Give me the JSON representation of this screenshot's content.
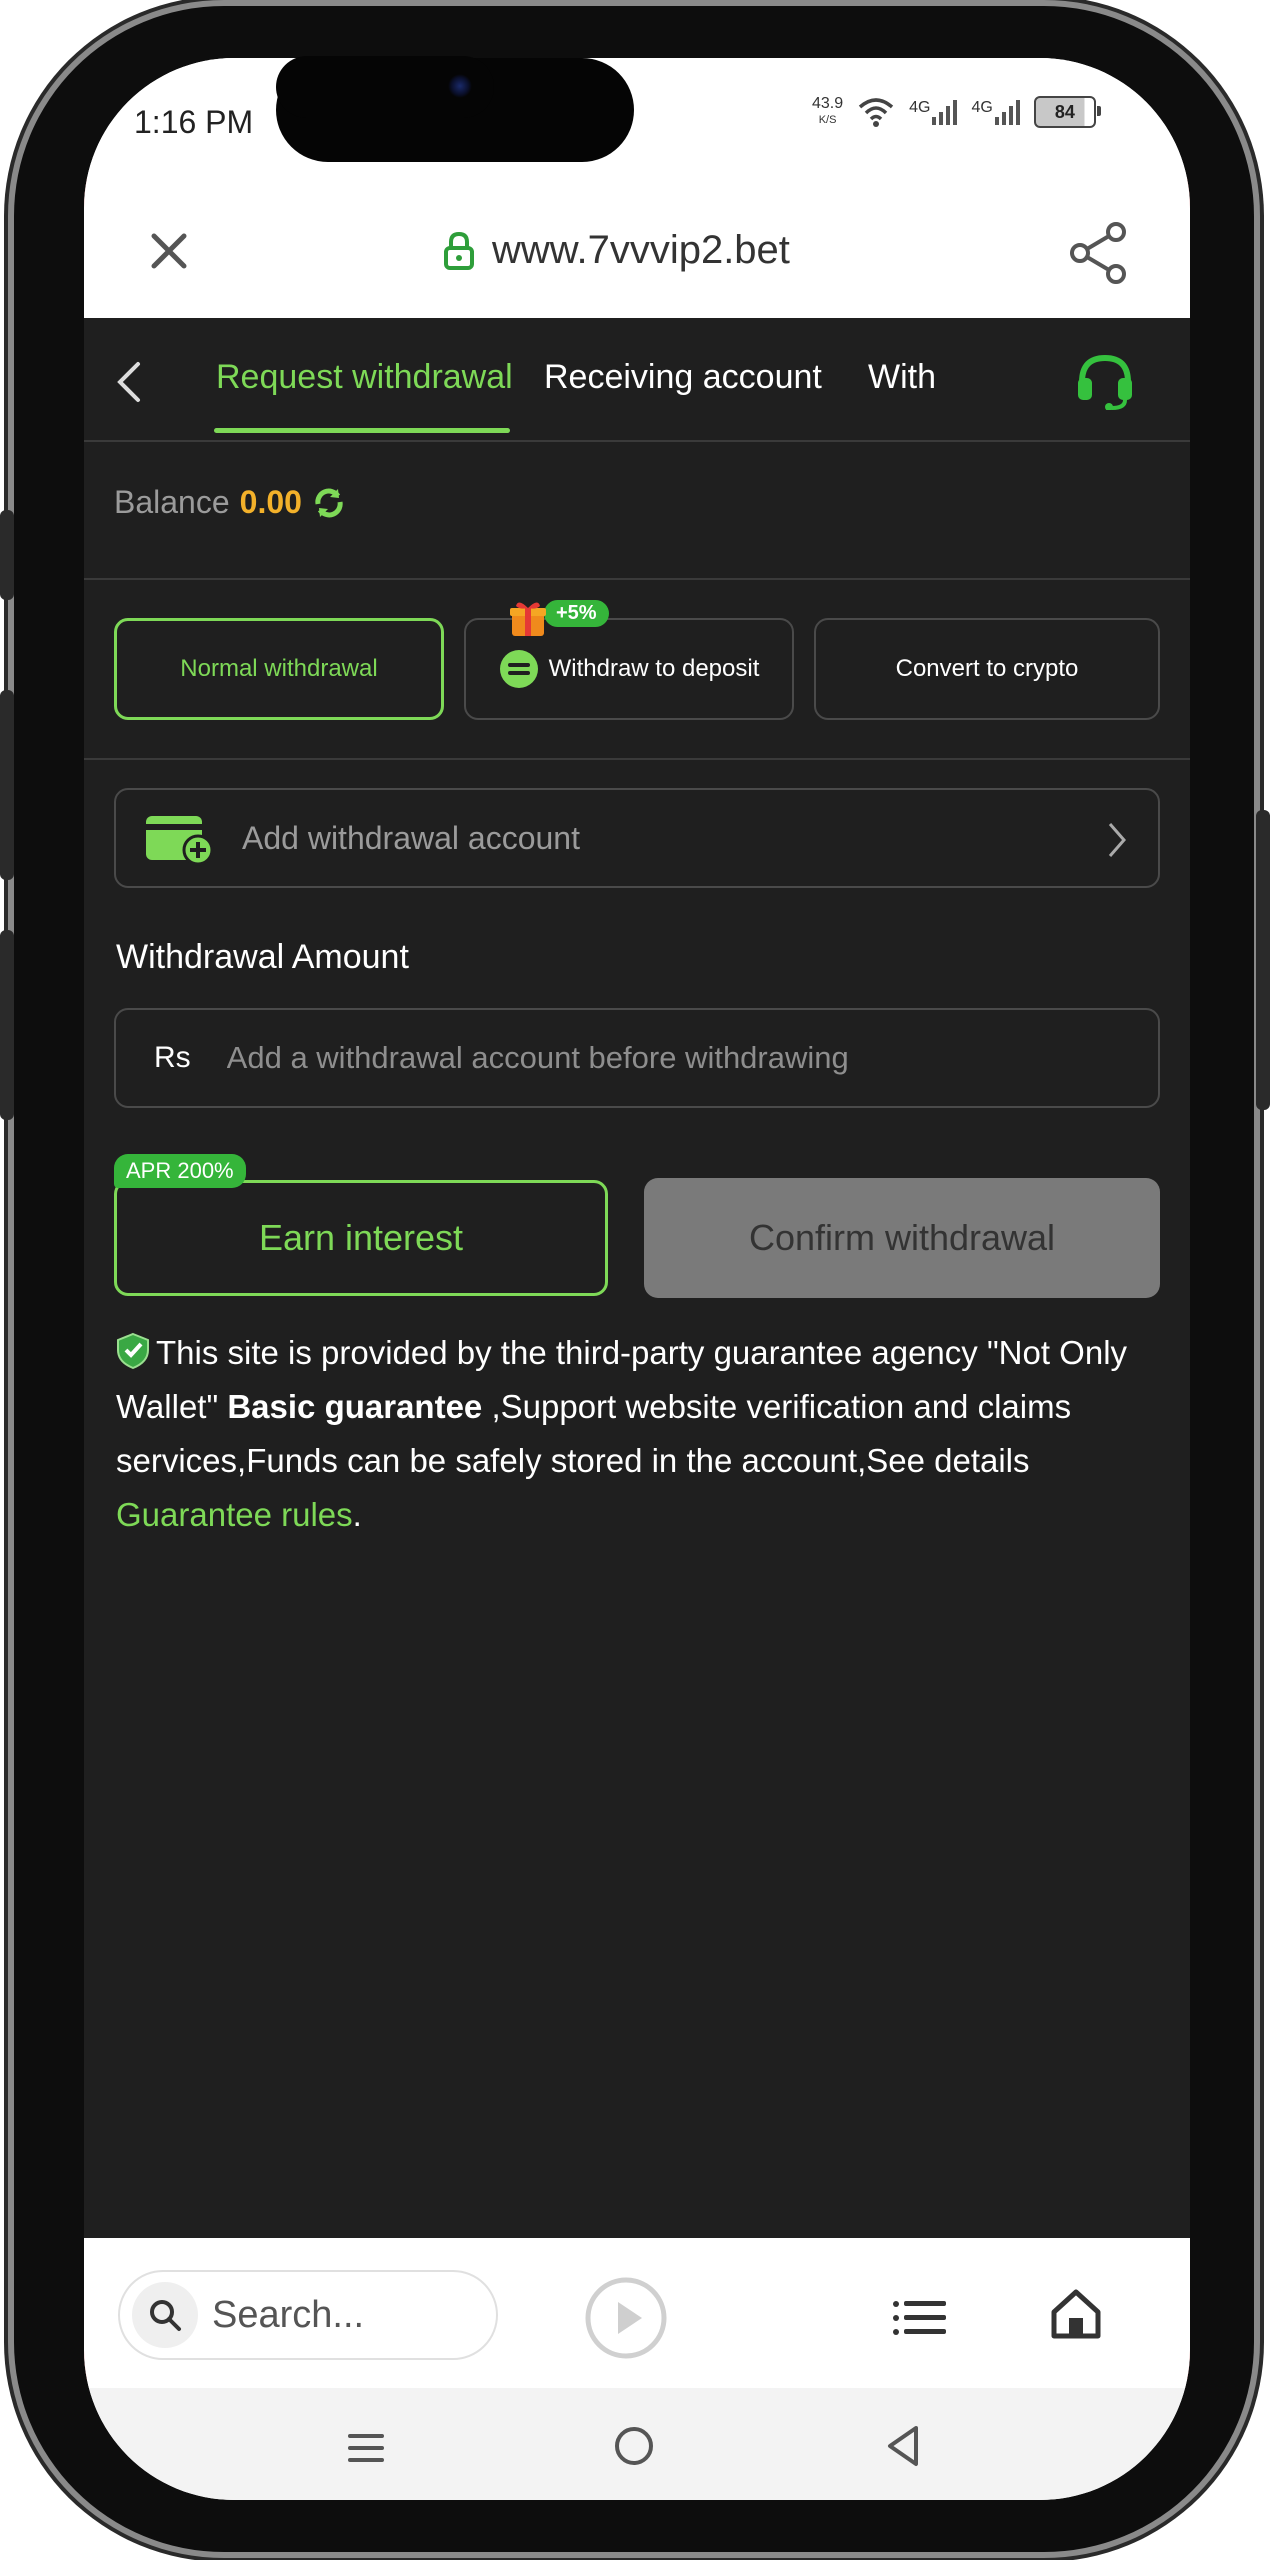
{
  "status_bar": {
    "time": "1:16 PM",
    "net_speed_value": "43.9",
    "net_speed_unit": "K/S",
    "signal_1": "4G",
    "signal_2": "4G",
    "battery": "84"
  },
  "url_bar": {
    "url": "www.7vvvip2.bet",
    "icons": [
      "close-icon",
      "lock-icon",
      "share-icon"
    ]
  },
  "tabs": [
    {
      "label": "Request withdrawal",
      "active": true
    },
    {
      "label": "Receiving account",
      "active": false
    },
    {
      "label": "With",
      "active": false
    }
  ],
  "balance": {
    "label": "Balance",
    "amount": "0.00"
  },
  "withdraw_types": [
    {
      "label": "Normal withdrawal",
      "active": true
    },
    {
      "label": "Withdraw to deposit",
      "badge": "+5%",
      "active": false
    },
    {
      "label": "Convert to crypto",
      "active": false
    }
  ],
  "add_account": {
    "label": "Add withdrawal account"
  },
  "amount": {
    "label": "Withdrawal Amount",
    "currency": "Rs",
    "placeholder": "Add a withdrawal account before withdrawing"
  },
  "earn": {
    "badge": "APR 200%",
    "label": "Earn interest"
  },
  "confirm": {
    "label": "Confirm withdrawal"
  },
  "guarantee": {
    "text_1": "This site is provided by the third-party guarantee agency \"Not Only Wallet\" ",
    "bold": "Basic guarantee",
    "text_2": " ,Support website verification and claims services,Funds can be safely stored in the account,See details ",
    "link": "Guarantee rules",
    "text_3": "."
  },
  "bottom_bar": {
    "search_placeholder": "Search..."
  },
  "colors": {
    "accent": "#7ed957",
    "balance": "#f3b12a",
    "background": "#1f1f1f",
    "badge": "#35b53a"
  }
}
